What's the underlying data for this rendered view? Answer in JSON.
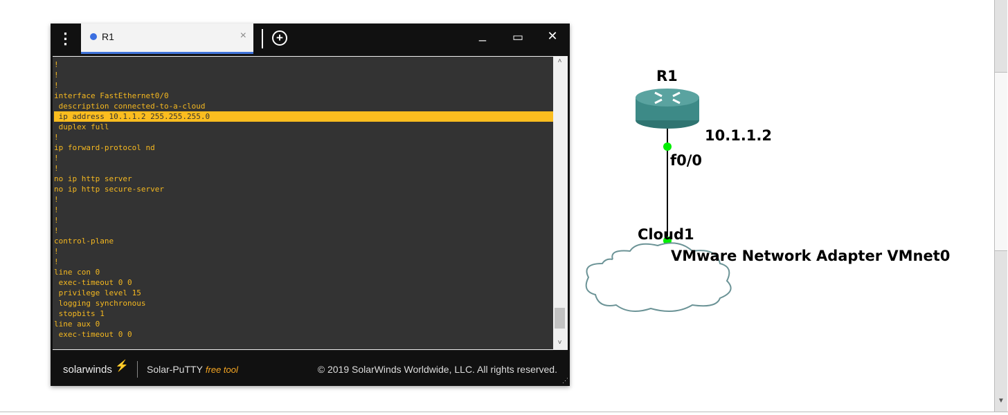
{
  "terminal_window": {
    "tab_label": "R1",
    "tab_status_color": "#3a6ee0",
    "menu_icon": "vertical-dots-icon",
    "close_tab": "×",
    "add_tab": "+",
    "minimize": "_",
    "maximize": "▭",
    "close": "✕",
    "lines": [
      "!",
      "!",
      "!",
      "interface FastEthernet0/0",
      " description connected-to-a-cloud",
      " ip address 10.1.1.2 255.255.255.0",
      " duplex full",
      "!",
      "ip forward-protocol nd",
      "!",
      "!",
      "no ip http server",
      "no ip http secure-server",
      "!",
      "!",
      "!",
      "!",
      "control-plane",
      "!",
      "!",
      "line con 0",
      " exec-timeout 0 0",
      " privilege level 15",
      " logging synchronous",
      " stopbits 1",
      "line aux 0",
      " exec-timeout 0 0"
    ],
    "highlighted_line": 5,
    "text_color": "#f5b820",
    "highlight_color": "#fbbd1f",
    "footer": {
      "logo": "solarwinds",
      "product": "Solar-PuTTY",
      "product_tag": "free tool",
      "copyright": "© 2019 SolarWinds Worldwide, LLC. All rights reserved."
    }
  },
  "topology": {
    "router": {
      "name": "R1",
      "ip": "10.1.1.2",
      "interface": "f0/0",
      "color": "#3d8a87"
    },
    "cloud": {
      "name": "Cloud1",
      "adapter": "VMware Network Adapter VMnet0"
    },
    "link_status_color": "#00ee00"
  }
}
